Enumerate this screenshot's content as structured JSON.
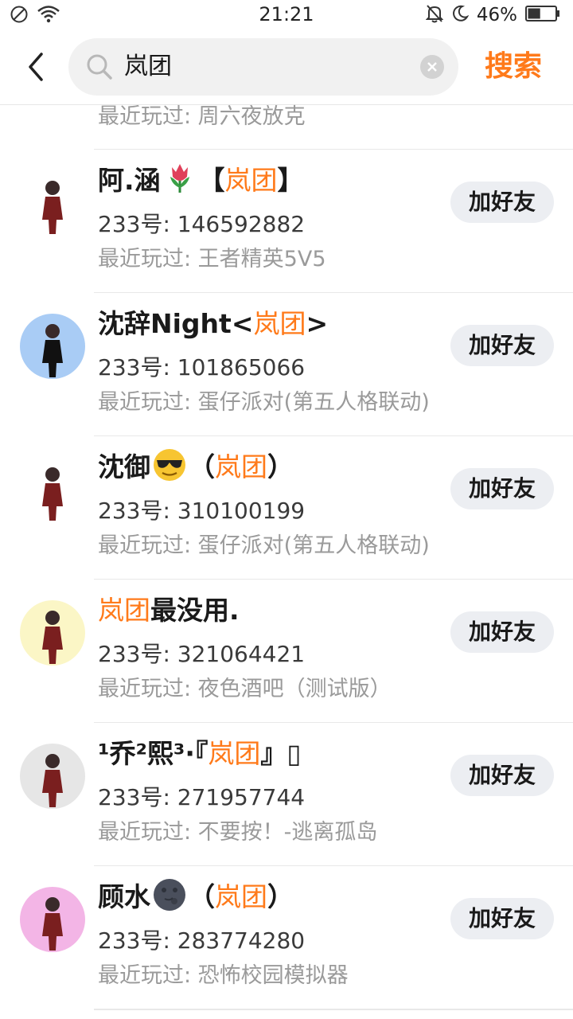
{
  "status_bar": {
    "time": "21:21",
    "battery_percent": "46%",
    "battery_level": 0.46
  },
  "search": {
    "query": "岚团",
    "action_label": "搜索"
  },
  "partial_row": {
    "recent": "最近玩过: 周六夜放克"
  },
  "results": [
    {
      "name_pre": "阿.涵",
      "emoji": "tulip",
      "name_mid": "【",
      "name_hl": "岚团",
      "name_post": "】",
      "uid": "233号: 146592882",
      "recent": "最近玩过: 王者精英5V5",
      "button": "加好友",
      "avatar_color": "#ffffff"
    },
    {
      "name_pre": "沈辞Night<",
      "emoji": "",
      "name_mid": "",
      "name_hl": "岚团",
      "name_post": ">",
      "uid": "233号: 101865066",
      "recent": "最近玩过: 蛋仔派对(第五人格联动)",
      "button": "加好友",
      "avatar_color": "#a9ccf5"
    },
    {
      "name_pre": "沈御",
      "emoji": "sunglasses",
      "name_mid": "（",
      "name_hl": "岚团",
      "name_post": "）",
      "uid": "233号: 310100199",
      "recent": "最近玩过: 蛋仔派对(第五人格联动)",
      "button": "加好友",
      "avatar_color": "#ffffff"
    },
    {
      "name_pre": "",
      "emoji": "",
      "name_mid": "",
      "name_hl": "岚团",
      "name_post": "最没用.",
      "uid": "233号: 321064421",
      "recent": "最近玩过: 夜色酒吧（测试版）",
      "button": "加好友",
      "avatar_color": "#fbf6c6"
    },
    {
      "name_pre": "¹乔²熙³·『",
      "emoji": "",
      "name_mid": "",
      "name_hl": "岚团",
      "name_post": "』▯",
      "uid": "233号: 271957744",
      "recent": "最近玩过: 不要按！-逃离孤岛",
      "button": "加好友",
      "avatar_color": "#e6e6e6"
    },
    {
      "name_pre": "顾水",
      "emoji": "moon",
      "name_mid": "（",
      "name_hl": "岚团",
      "name_post": "）",
      "uid": "233号: 283774280",
      "recent": "最近玩过: 恐怖校园模拟器",
      "button": "加好友",
      "avatar_color": "#f3b5e6"
    }
  ],
  "colors": {
    "accent": "#ff7a1a",
    "button_bg": "#eceef2",
    "secondary_text": "#9a9a9a"
  },
  "icons": [
    "no-disturb-icon",
    "wifi-icon",
    "bell-off-icon",
    "moon-icon",
    "battery-icon",
    "back-icon",
    "search-icon",
    "clear-icon"
  ]
}
